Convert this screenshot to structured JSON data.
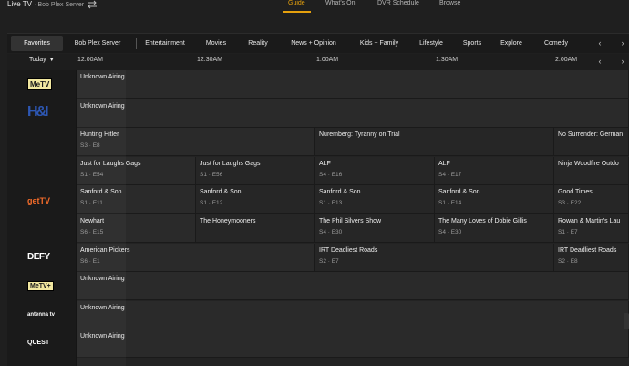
{
  "header": {
    "app_title": "Live TV",
    "server_label": "Bob Plex Server",
    "nav": [
      {
        "label": "Guide",
        "active": true
      },
      {
        "label": "What's On",
        "active": false
      },
      {
        "label": "DVR Schedule",
        "active": false
      },
      {
        "label": "Browse",
        "active": false
      }
    ]
  },
  "categories": [
    "Favorites",
    "Bob Plex Server",
    "Entertainment",
    "Movies",
    "Reality",
    "News + Opinion",
    "Kids + Family",
    "Lifestyle",
    "Sports",
    "Explore",
    "Comedy"
  ],
  "active_category": "Favorites",
  "timebar": {
    "day": "Today",
    "times": [
      "12:00AM",
      "12:30AM",
      "1:00AM",
      "1:30AM",
      "2:00AM"
    ]
  },
  "channels": [
    {
      "logo": "MeTV",
      "icon": "metv-logo",
      "programs": [
        {
          "title": "Unknown Airing",
          "ep": ""
        }
      ]
    },
    {
      "logo": "H&I",
      "icon": "hi-logo",
      "programs": [
        {
          "title": "Unknown Airing",
          "ep": ""
        }
      ]
    },
    {
      "logo": "",
      "icon": "",
      "programs": [
        {
          "title": "Hunting Hitler",
          "ep": "S3 · E8"
        },
        {
          "title": "Nuremberg: Tyranny on Trial",
          "ep": ""
        },
        {
          "title": "No Surrender: German",
          "ep": ""
        }
      ]
    },
    {
      "logo": "",
      "icon": "",
      "programs": [
        {
          "title": "Just for Laughs Gags",
          "ep": "S1 · E54"
        },
        {
          "title": "Just for Laughs Gags",
          "ep": "S1 · E56"
        },
        {
          "title": "ALF",
          "ep": "S4 · E16"
        },
        {
          "title": "ALF",
          "ep": "S4 · E17"
        },
        {
          "title": "Ninja Woodfire Outdo",
          "ep": ""
        }
      ]
    },
    {
      "logo": "getTV",
      "icon": "gettv-logo",
      "programs": [
        {
          "title": "Sanford & Son",
          "ep": "S1 · E11"
        },
        {
          "title": "Sanford & Son",
          "ep": "S1 · E12"
        },
        {
          "title": "Sanford & Son",
          "ep": "S1 · E13"
        },
        {
          "title": "Sanford & Son",
          "ep": "S1 · E14"
        },
        {
          "title": "Good Times",
          "ep": "S3 · E22"
        }
      ]
    },
    {
      "logo": "",
      "icon": "",
      "programs": [
        {
          "title": "Newhart",
          "ep": "S6 · E15"
        },
        {
          "title": "The Honeymooners",
          "ep": ""
        },
        {
          "title": "The Phil Silvers Show",
          "ep": "S4 · E30"
        },
        {
          "title": "The Many Loves of Dobie Gillis",
          "ep": "S4 · E30"
        },
        {
          "title": "Rowan & Martin's Lau",
          "ep": "S1 · E7"
        }
      ]
    },
    {
      "logo": "DEFY",
      "icon": "defy-logo",
      "programs": [
        {
          "title": "American Pickers",
          "ep": "S6 · E1"
        },
        {
          "title": "IRT Deadliest Roads",
          "ep": "S2 · E7"
        },
        {
          "title": "IRT Deadliest Roads",
          "ep": "S2 · E8"
        }
      ]
    },
    {
      "logo": "MeTV+",
      "icon": "metv-plus-logo",
      "programs": [
        {
          "title": "Unknown Airing",
          "ep": ""
        }
      ]
    },
    {
      "logo": "antenna tv",
      "icon": "antenna-tv-logo",
      "programs": [
        {
          "title": "Unknown Airing",
          "ep": ""
        }
      ]
    },
    {
      "logo": "QUEST",
      "icon": "quest-logo",
      "programs": [
        {
          "title": "Unknown Airing",
          "ep": ""
        }
      ]
    }
  ],
  "colors": {
    "accent": "#e5a00d",
    "background": "#1f1f1f",
    "cell": "#262626"
  }
}
